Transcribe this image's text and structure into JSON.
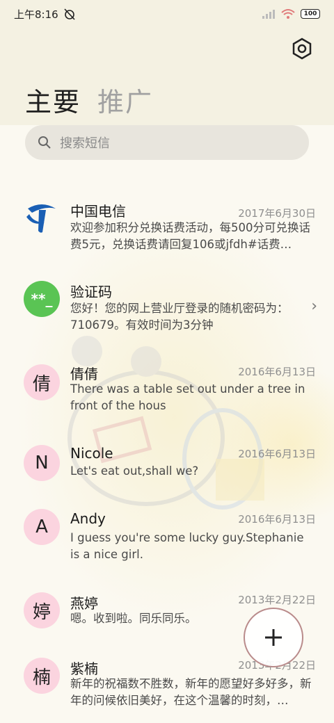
{
  "status_bar": {
    "time": "上午8:16",
    "battery": "100"
  },
  "tabs": [
    {
      "label": "主要",
      "active": true
    },
    {
      "label": "推广",
      "active": false
    }
  ],
  "search": {
    "placeholder": "搜索短信"
  },
  "icons": {
    "settings": "settings-hex-icon",
    "search": "search-icon",
    "compose": "plus-icon"
  },
  "colors": {
    "avatar_pink": "#fbd4df",
    "avatar_green": "#5ac454",
    "telecom_blue": "#1a5fb4",
    "fab_border": "#b98b8b"
  },
  "messages": [
    {
      "name": "中国电信",
      "date": "2017年6月30日",
      "preview": "欢迎参加积分兑换话费活动，每500分可兑换话费5元，兑换话费请回复106或jfdh#话费…",
      "avatar": "",
      "avatar_type": "telecom-logo"
    },
    {
      "name": "验证码",
      "date": "",
      "preview": "您好！您的网上营业厅登录的随机密码为：710679。有效时间为3分钟",
      "avatar": "**_",
      "avatar_type": "green"
    },
    {
      "name": "倩倩",
      "date": "2016年6月13日",
      "preview": "There was a table set out under a tree in front of the hous",
      "avatar": "倩",
      "avatar_type": "pink"
    },
    {
      "name": "Nicole",
      "date": "2016年6月13日",
      "preview": "Let's eat out,shall we?",
      "avatar": "N",
      "avatar_type": "pink"
    },
    {
      "name": "Andy",
      "date": "2016年6月13日",
      "preview": "I guess you're some lucky guy.Stephanie is a nice girl.",
      "avatar": "A",
      "avatar_type": "pink"
    },
    {
      "name": "燕婷",
      "date": "2013年2月22日",
      "preview": "嗯。收到啦。同乐同乐。",
      "avatar": "婷",
      "avatar_type": "pink"
    },
    {
      "name": "紫楠",
      "date": "2013年2月22日",
      "preview": "新年的祝福数不胜数，新年的愿望好多好多，新年的问候依旧美好，在这个温馨的时刻，…",
      "avatar": "楠",
      "avatar_type": "pink"
    }
  ]
}
